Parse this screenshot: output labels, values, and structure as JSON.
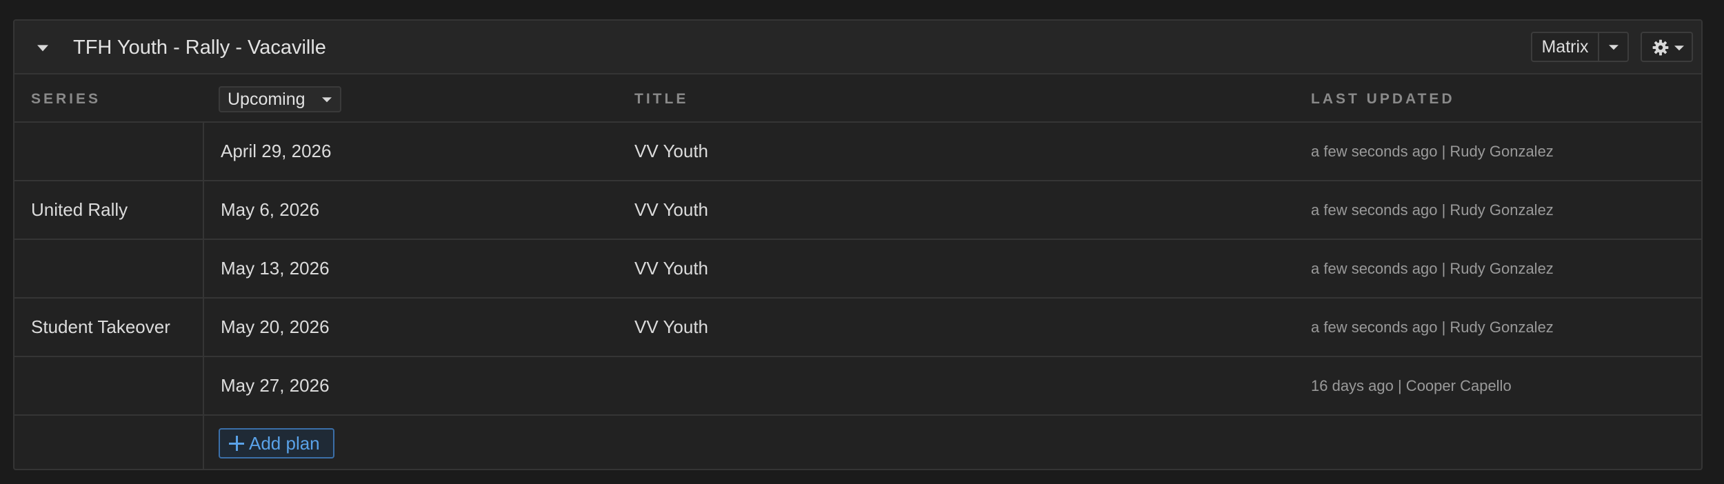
{
  "panel": {
    "title": "TFH Youth - Rally - Vacaville",
    "view_label": "Matrix"
  },
  "columns": {
    "series": "SERIES",
    "filter": "Upcoming",
    "title": "TITLE",
    "last_updated": "LAST UPDATED"
  },
  "rows": [
    {
      "series": "",
      "date": "April 29, 2026",
      "title": "VV Youth",
      "updated": "a few seconds ago | Rudy Gonzalez"
    },
    {
      "series": "United Rally",
      "date": "May 6, 2026",
      "title": "VV Youth",
      "updated": "a few seconds ago | Rudy Gonzalez"
    },
    {
      "series": "",
      "date": "May 13, 2026",
      "title": "VV Youth",
      "updated": "a few seconds ago | Rudy Gonzalez"
    },
    {
      "series": "Student Takeover",
      "date": "May 20, 2026",
      "title": "VV Youth",
      "updated": "a few seconds ago | Rudy Gonzalez"
    },
    {
      "series": "",
      "date": "May 27, 2026",
      "title": "",
      "updated": "16 days ago | Cooper Capello"
    }
  ],
  "add_plan_label": "Add plan",
  "icons": {
    "collapse": "chevron-down-icon",
    "view_caret": "caret-down-icon",
    "settings": "gear-icon",
    "add": "plus-icon"
  },
  "colors": {
    "accent": "#5aa2e8",
    "background": "#1b1b1b",
    "panel": "#222222"
  }
}
